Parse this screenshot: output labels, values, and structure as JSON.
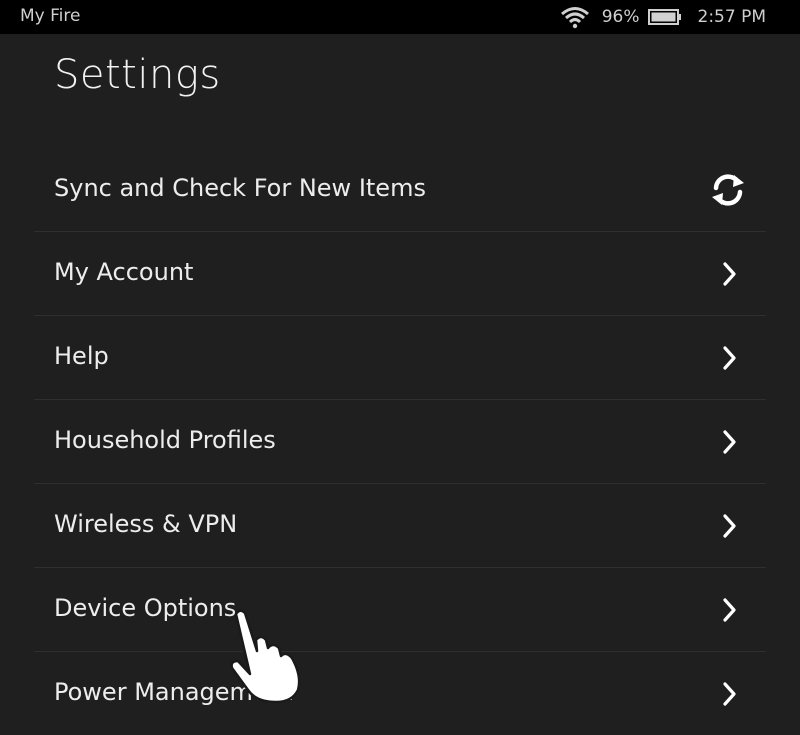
{
  "status_bar": {
    "title": "My Fire",
    "battery_percent": "96%",
    "time": "2:57 PM",
    "icons": [
      "wifi-icon",
      "battery-icon"
    ]
  },
  "header": {
    "title": "Settings"
  },
  "settings": {
    "items": [
      {
        "label": "Sync and Check For New Items",
        "icon": "sync-icon"
      },
      {
        "label": "My Account",
        "icon": "chevron-right-icon"
      },
      {
        "label": "Help",
        "icon": "chevron-right-icon"
      },
      {
        "label": "Household Profiles",
        "icon": "chevron-right-icon"
      },
      {
        "label": "Wireless & VPN",
        "icon": "chevron-right-icon"
      },
      {
        "label": "Device Options",
        "icon": "chevron-right-icon"
      },
      {
        "label": "Power Management",
        "icon": "chevron-right-icon"
      }
    ]
  },
  "colors": {
    "background": "#1f1f1f",
    "status_bar": "#000000",
    "divider": "#2f2f2f",
    "text": "#ededed"
  }
}
